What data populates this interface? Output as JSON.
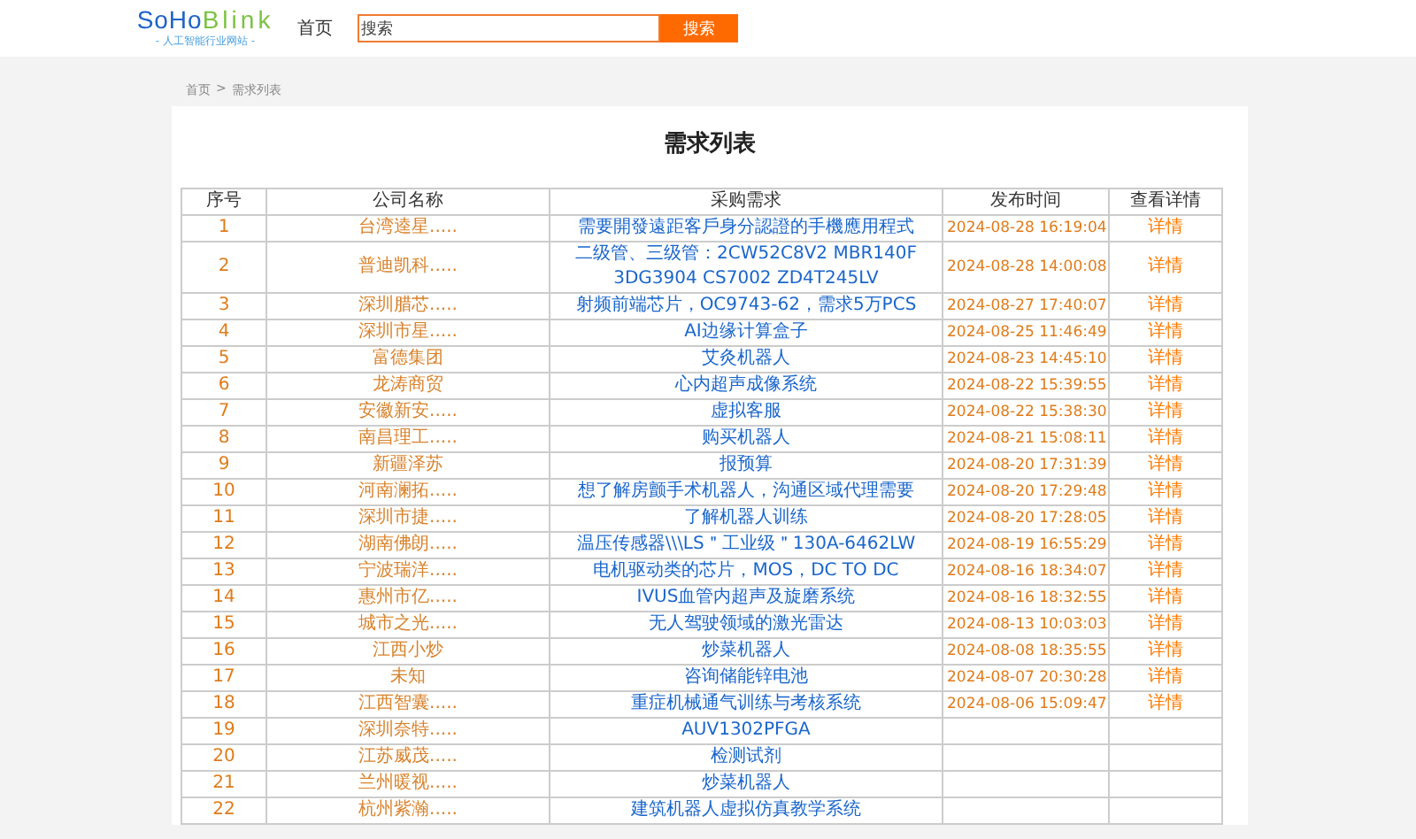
{
  "header": {
    "logo": {
      "part1": "SoHo",
      "part2": "Blink",
      "tagline": "- 人工智能行业网站 -"
    },
    "nav": [
      "首页"
    ],
    "search": {
      "placeholder": "搜索",
      "button": "搜索"
    }
  },
  "breadcrumb": [
    "首页",
    "需求列表"
  ],
  "breadcrumb_separator": ">",
  "title": "需求列表",
  "table": {
    "columns": [
      "序号",
      "公司名称",
      "采购需求",
      "发布时间",
      "查看详情"
    ],
    "rows": [
      {
        "index": "1",
        "company": "台湾逵星.....",
        "demand": "需要開發遠距客戶身分認證的手機應用程式",
        "time": "2024-08-28 16:19:04",
        "detail": "详情"
      },
      {
        "index": "2",
        "company": "普迪凯科.....",
        "demand": "二级管、三级管：2CW52C8V2 MBR140F 3DG3904 CS7002 ZD4T245LV",
        "time": "2024-08-28 14:00:08",
        "detail": "详情"
      },
      {
        "index": "3",
        "company": "深圳腊芯.....",
        "demand": "射频前端芯片，OC9743-62，需求5万PCS",
        "time": "2024-08-27 17:40:07",
        "detail": "详情"
      },
      {
        "index": "4",
        "company": "深圳市星.....",
        "demand": "AI边缘计算盒子",
        "time": "2024-08-25 11:46:49",
        "detail": "详情"
      },
      {
        "index": "5",
        "company": "富德集团",
        "demand": "艾灸机器人",
        "time": "2024-08-23 14:45:10",
        "detail": "详情"
      },
      {
        "index": "6",
        "company": "龙涛商贸",
        "demand": "心内超声成像系统",
        "time": "2024-08-22 15:39:55",
        "detail": "详情"
      },
      {
        "index": "7",
        "company": "安徽新安.....",
        "demand": "虚拟客服",
        "time": "2024-08-22 15:38:30",
        "detail": "详情"
      },
      {
        "index": "8",
        "company": "南昌理工.....",
        "demand": "购买机器人",
        "time": "2024-08-21 15:08:11",
        "detail": "详情"
      },
      {
        "index": "9",
        "company": "新疆泽苏",
        "demand": "报预算",
        "time": "2024-08-20 17:31:39",
        "detail": "详情"
      },
      {
        "index": "10",
        "company": "河南澜拓.....",
        "demand": "想了解房颤手术机器人，沟通区域代理需要",
        "time": "2024-08-20 17:29:48",
        "detail": "详情"
      },
      {
        "index": "11",
        "company": "深圳市捷.....",
        "demand": "了解机器人训练",
        "time": "2024-08-20 17:28:05",
        "detail": "详情"
      },
      {
        "index": "12",
        "company": "湖南佛朗.....",
        "demand": "温压传感器\\\\\\LS＂工业级＂130A-6462LW",
        "time": "2024-08-19 16:55:29",
        "detail": "详情"
      },
      {
        "index": "13",
        "company": "宁波瑞洋.....",
        "demand": "电机驱动类的芯片，MOS，DC TO DC",
        "time": "2024-08-16 18:34:07",
        "detail": "详情"
      },
      {
        "index": "14",
        "company": "惠州市亿.....",
        "demand": "IVUS血管内超声及旋磨系统",
        "time": "2024-08-16 18:32:55",
        "detail": "详情"
      },
      {
        "index": "15",
        "company": "城市之光.....",
        "demand": "无人驾驶领域的激光雷达",
        "time": "2024-08-13 10:03:03",
        "detail": "详情"
      },
      {
        "index": "16",
        "company": "江西小炒",
        "demand": "炒菜机器人",
        "time": "2024-08-08 18:35:55",
        "detail": "详情"
      },
      {
        "index": "17",
        "company": "未知",
        "demand": "咨询储能锌电池",
        "time": "2024-08-07 20:30:28",
        "detail": "详情"
      },
      {
        "index": "18",
        "company": "江西智囊.....",
        "demand": "重症机械通气训练与考核系统",
        "time": "2024-08-06 15:09:47",
        "detail": "详情"
      },
      {
        "index": "19",
        "company": "深圳奈特.....",
        "demand": "AUV1302PFGA"
      },
      {
        "index": "20",
        "company": "江苏威茂.....",
        "demand": "检测试剂"
      },
      {
        "index": "21",
        "company": "兰州暖视.....",
        "demand": "炒菜机器人"
      },
      {
        "index": "22",
        "company": "杭州紫瀚.....",
        "demand": "建筑机器人虚拟仿真教学系统"
      }
    ]
  }
}
